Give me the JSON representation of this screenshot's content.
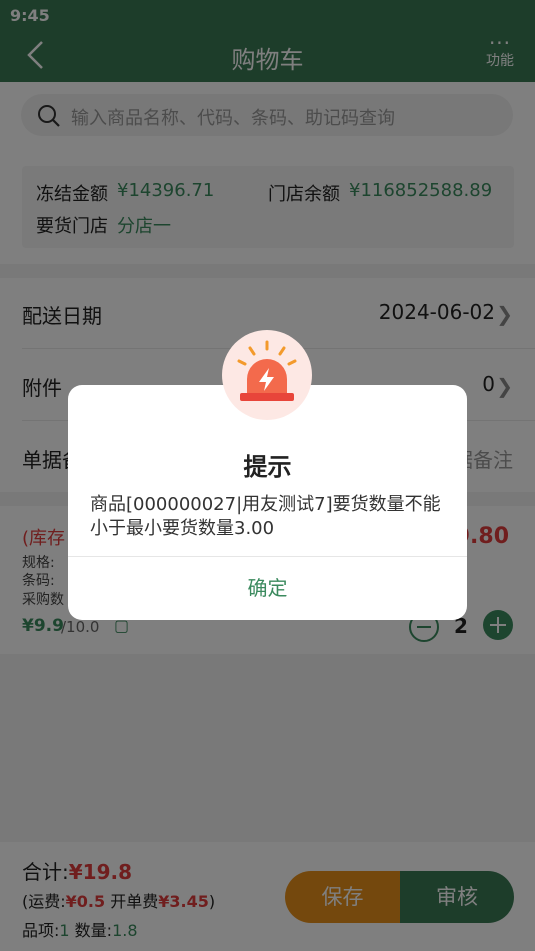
{
  "status_bar": {
    "time": "9:45"
  },
  "nav": {
    "title": "购物车",
    "func_label": "功能"
  },
  "search": {
    "placeholder": "输入商品名称、代码、条码、助记码查询"
  },
  "info": {
    "frozen_label": "冻结金额",
    "frozen_value": "¥14396.71",
    "store_balance_label": "门店余额",
    "store_balance_value": "¥116852588.89",
    "store_label": "要货门店",
    "store_value": "分店一"
  },
  "rows": {
    "delivery_date_label": "配送日期",
    "delivery_date_value": "2024-06-02",
    "attachment_label": "附件",
    "attachment_value": "0",
    "remark_label": "单据备",
    "remark_hint": "据备注"
  },
  "item": {
    "stock_prefix": "(库存",
    "spec_label": "规格:",
    "barcode_label": "条码:",
    "purchase_label": "采购数",
    "price": "¥9.9",
    "unit_price": "/10.0",
    "amount": "9.80",
    "quantity": "2"
  },
  "bottom": {
    "total_label": "合计:",
    "total_value": "¥19.8",
    "freight_open": "(运费:",
    "freight_value": "¥0.5",
    "fee_label": " 开单费",
    "fee_value": "¥3.45",
    "close_paren": ")",
    "items_label": "品项:",
    "items_value": "1",
    "qty_label": " 数量:",
    "qty_value": "1.8",
    "save_label": "保存",
    "audit_label": "审核"
  },
  "dialog": {
    "title": "提示",
    "message": "商品[000000027|用友测试7]要货数量不能小于最小要货数量3.00",
    "confirm_label": "确定"
  },
  "colors": {
    "primary": "#3b7a55",
    "accent_green": "#3b8a5e",
    "price_red": "#e03c3c",
    "save_orange": "#e8901a"
  }
}
